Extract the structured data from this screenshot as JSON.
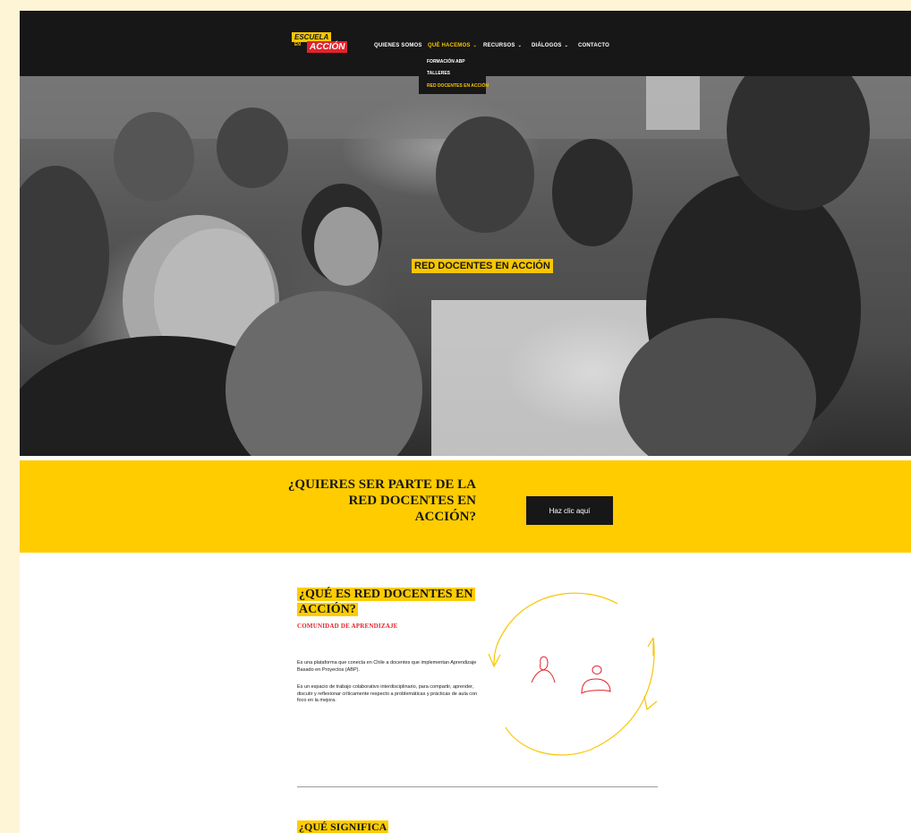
{
  "nav": {
    "logo_top": "ESCUELA",
    "logo_mid": "EN",
    "logo_bottom": "ACCIÓN",
    "items": [
      {
        "label": "QUIENES SOMOS"
      },
      {
        "label": "QUÉ HACEMOS",
        "active": true
      },
      {
        "label": "RECURSOS"
      },
      {
        "label": "DIÁLOGOS"
      },
      {
        "label": "CONTACTO"
      }
    ],
    "dropdown": [
      "FORMACIÓN ABP",
      "TALLERES",
      "RED DOCENTES EN ACCIÓN"
    ]
  },
  "hero": {
    "title": "RED DOCENTES EN ACCIÓN"
  },
  "cta": {
    "question_lines": [
      "¿QUIERES SER PARTE DE LA",
      "RED DOCENTES EN",
      "ACCIÓN?"
    ],
    "button_label": "Haz clic aquí"
  },
  "section1": {
    "title_lines": [
      "¿QUÉ ES RED DOCENTES EN",
      "ACCIÓN?"
    ],
    "subtitle": "COMUNIDAD DE APRENDIZAJE",
    "paragraph1": "Es una plataforma que conecta en Chile a docentes que implementan Aprendizaje Basado en Proyectos (ABP).",
    "paragraph2": "Es un espacio de trabajo colaborativo interdisciplinario, para compartir, aprender, discutir y reflexionar críticamente respecto a problemáticas y prácticas de aula con foco en la mejora."
  },
  "section2": {
    "title": "¿QUÉ SIGNIFICA"
  },
  "colors": {
    "accent_yellow": "#ffcc00",
    "accent_red": "#e1232c",
    "dark": "#171717",
    "page_bg": "#fef4d6"
  }
}
